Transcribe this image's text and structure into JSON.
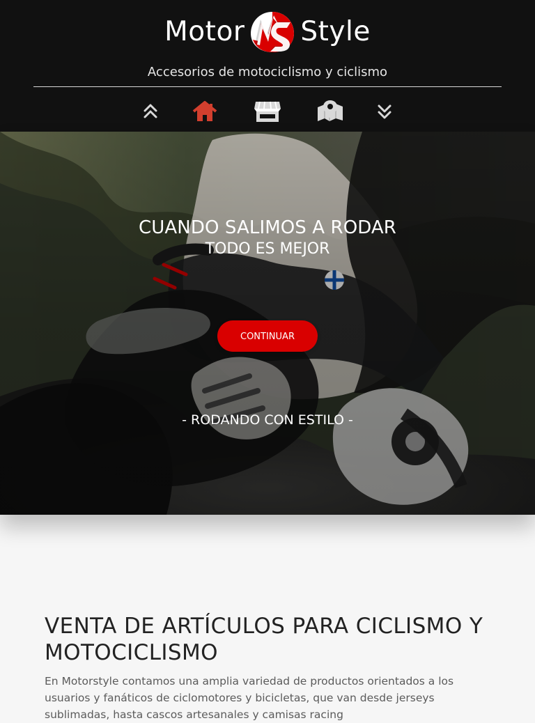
{
  "header": {
    "logo_left": "Motor",
    "logo_right": "Style",
    "tagline": "Accesorios de motociclismo y ciclismo",
    "brand_colors": {
      "background": "#111111",
      "accent": "#d90000",
      "icon_gray": "#d9d9d9"
    }
  },
  "nav": {
    "items": [
      {
        "name": "scroll-up",
        "icon": "double-chevron-up-icon"
      },
      {
        "name": "home",
        "icon": "home-icon"
      },
      {
        "name": "store",
        "icon": "store-icon"
      },
      {
        "name": "map",
        "icon": "map-pin-icon"
      },
      {
        "name": "scroll-down",
        "icon": "double-chevron-down-icon"
      }
    ]
  },
  "hero": {
    "title_line_1": "CUANDO SALIMOS A RODAR",
    "title_line_2": "TODO ES MEJOR",
    "button_label": "CONTINUAR",
    "slogan": "- RODANDO CON ESTILO -"
  },
  "content": {
    "title": "VENTA DE ARTÍCULOS PARA CICLISMO Y MOTOCICLISMO",
    "text": "En Motorstyle contamos una amplia variedad de productos orientados a los usuarios y fanáticos de ciclomotores y bicicletas, que van desde jerseys sublimadas, hasta cascos artesanales y camisas racing"
  }
}
